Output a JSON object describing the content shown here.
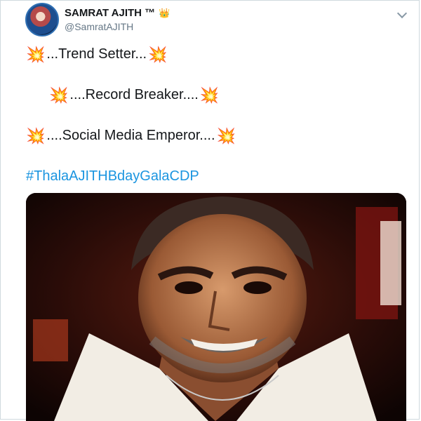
{
  "tweet": {
    "display_name": "SAMRAT AJITH ™",
    "crown_icon": "crown-icon",
    "handle": "@SamratAJITH",
    "lines": [
      {
        "text": "...Trend Setter..."
      },
      {
        "text": "....Record Breaker...."
      },
      {
        "text": "....Social Media Emperor...."
      }
    ],
    "burst_glyph": "💥",
    "hashtag": "#ThalaAJITHBdayGalaCDP"
  },
  "colors": {
    "hashtag": "#1b95e0",
    "handle": "#657786",
    "burst": "#e0245e"
  }
}
